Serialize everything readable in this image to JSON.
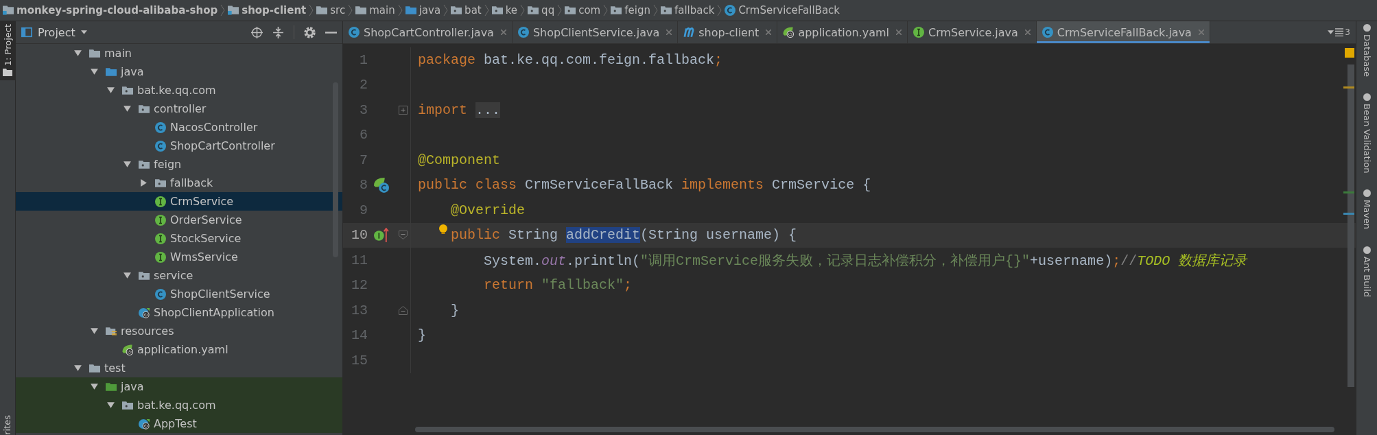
{
  "breadcrumbs": [
    {
      "label": "monkey-spring-cloud-alibaba-shop",
      "kind": "module"
    },
    {
      "label": "shop-client",
      "kind": "module"
    },
    {
      "label": "src",
      "kind": "folder"
    },
    {
      "label": "main",
      "kind": "folder"
    },
    {
      "label": "java",
      "kind": "source"
    },
    {
      "label": "bat",
      "kind": "package"
    },
    {
      "label": "ke",
      "kind": "package"
    },
    {
      "label": "qq",
      "kind": "package"
    },
    {
      "label": "com",
      "kind": "package"
    },
    {
      "label": "feign",
      "kind": "package"
    },
    {
      "label": "fallback",
      "kind": "package"
    },
    {
      "label": "CrmServiceFallBack",
      "kind": "class"
    }
  ],
  "left_strip": {
    "project_label": "1: Project",
    "favorites_label": "rites"
  },
  "project_panel": {
    "title": "Project",
    "tree": [
      {
        "label": "main",
        "kind": "folder",
        "expanded": true,
        "selected": false,
        "children": [
          {
            "label": "java",
            "kind": "source",
            "expanded": true,
            "selected": false,
            "children": [
              {
                "label": "bat.ke.qq.com",
                "kind": "package",
                "expanded": true,
                "selected": false,
                "children": [
                  {
                    "label": "controller",
                    "kind": "package",
                    "expanded": true,
                    "selected": false,
                    "children": [
                      {
                        "label": "NacosController",
                        "kind": "class",
                        "selected": false
                      },
                      {
                        "label": "ShopCartController",
                        "kind": "class",
                        "selected": false
                      }
                    ]
                  },
                  {
                    "label": "feign",
                    "kind": "package",
                    "expanded": true,
                    "selected": false,
                    "children": [
                      {
                        "label": "fallback",
                        "kind": "package",
                        "expanded": false,
                        "selected": false
                      },
                      {
                        "label": "CrmService",
                        "kind": "interface",
                        "selected": true
                      },
                      {
                        "label": "OrderService",
                        "kind": "interface",
                        "selected": false
                      },
                      {
                        "label": "StockService",
                        "kind": "interface",
                        "selected": false
                      },
                      {
                        "label": "WmsService",
                        "kind": "interface",
                        "selected": false
                      }
                    ]
                  },
                  {
                    "label": "service",
                    "kind": "package",
                    "expanded": true,
                    "selected": false,
                    "children": [
                      {
                        "label": "ShopClientService",
                        "kind": "class",
                        "selected": false
                      }
                    ]
                  },
                  {
                    "label": "ShopClientApplication",
                    "kind": "app",
                    "selected": false
                  }
                ]
              }
            ]
          },
          {
            "label": "resources",
            "kind": "resources",
            "expanded": true,
            "selected": false,
            "children": [
              {
                "label": "application.yaml",
                "kind": "yaml",
                "selected": false
              }
            ]
          }
        ]
      },
      {
        "label": "test",
        "kind": "folder",
        "expanded": true,
        "selected": false,
        "children": [
          {
            "label": "java",
            "kind": "test-source",
            "expanded": true,
            "selected": false,
            "children": [
              {
                "label": "bat.ke.qq.com",
                "kind": "package",
                "expanded": true,
                "selected": false,
                "children": [
                  {
                    "label": "AppTest",
                    "kind": "app",
                    "selected": false
                  }
                ]
              }
            ]
          }
        ]
      }
    ]
  },
  "tabs": [
    {
      "label": "ShopCartController.java",
      "kind": "class",
      "selected": false
    },
    {
      "label": "ShopClientService.java",
      "kind": "class",
      "selected": false
    },
    {
      "label": "shop-client",
      "kind": "maven",
      "selected": false
    },
    {
      "label": "application.yaml",
      "kind": "yaml",
      "selected": false
    },
    {
      "label": "CrmService.java",
      "kind": "interface",
      "selected": false
    },
    {
      "label": "CrmServiceFallBack.java",
      "kind": "class",
      "selected": true
    }
  ],
  "recent_count": "3",
  "code_lines": [
    {
      "number": "1",
      "current": false,
      "tokens": [
        {
          "text": "package",
          "kind": "keyword"
        },
        {
          "text": " bat.ke.qq.com.feign.fallback",
          "kind": "plain"
        },
        {
          "text": ";",
          "kind": "keyword"
        }
      ]
    },
    {
      "number": "2",
      "current": false
    },
    {
      "number": "3",
      "current": false,
      "fold_marker": {
        "kind": "collapsed"
      },
      "tokens": [
        {
          "text": "import ",
          "kind": "keyword"
        },
        {
          "text": "...",
          "kind": "folded"
        }
      ]
    },
    {
      "number": "6",
      "current": false
    },
    {
      "number": "7",
      "current": false,
      "tokens": [
        {
          "text": "@Component",
          "kind": "annotation"
        }
      ]
    },
    {
      "number": "8",
      "current": false,
      "gutter_icon": {
        "kind": "bean"
      },
      "tokens": [
        {
          "text": "public class",
          "kind": "keyword"
        },
        {
          "text": " CrmServiceFallBack ",
          "kind": "plain"
        },
        {
          "text": "implements",
          "kind": "keyword"
        },
        {
          "text": " CrmService {",
          "kind": "plain"
        }
      ]
    },
    {
      "number": "9",
      "current": false,
      "tokens": [
        {
          "text": "    @Override",
          "kind": "annotation"
        }
      ]
    },
    {
      "number": "10",
      "current": true,
      "gutter_icon": {
        "kind": "implements"
      },
      "bulb": true,
      "fold_marker": {
        "kind": "open"
      },
      "tokens": [
        {
          "text": "    public",
          "kind": "keyword"
        },
        {
          "text": " String ",
          "kind": "plain"
        },
        {
          "text": "addCredit",
          "kind": "selection"
        },
        {
          "text": "(String username) {",
          "kind": "plain"
        }
      ]
    },
    {
      "number": "11",
      "current": false,
      "tokens": [
        {
          "text": "        System.",
          "kind": "plain"
        },
        {
          "text": "out",
          "kind": "static"
        },
        {
          "text": ".println(",
          "kind": "plain"
        },
        {
          "text": "\"调用CrmService服务失败，记录日志补偿积分，补偿用户{}\"",
          "kind": "string"
        },
        {
          "text": "+username)",
          "kind": "plain"
        },
        {
          "text": ";",
          "kind": "keyword"
        },
        {
          "text": "//",
          "kind": "comment"
        },
        {
          "text": "TODO 数据库记录",
          "kind": "todo"
        }
      ]
    },
    {
      "number": "12",
      "current": false,
      "tokens": [
        {
          "text": "        return ",
          "kind": "keyword"
        },
        {
          "text": "\"fallback\"",
          "kind": "string"
        },
        {
          "text": ";",
          "kind": "keyword"
        }
      ]
    },
    {
      "number": "13",
      "current": false,
      "fold_marker": {
        "kind": "end"
      },
      "tokens": [
        {
          "text": "    }",
          "kind": "plain"
        }
      ]
    },
    {
      "number": "14",
      "current": false,
      "tokens": [
        {
          "text": "}",
          "kind": "plain"
        }
      ]
    },
    {
      "number": "15",
      "current": false
    }
  ],
  "right_strip": [
    "Database",
    "Bean Validation",
    "Maven",
    "Ant Build"
  ]
}
